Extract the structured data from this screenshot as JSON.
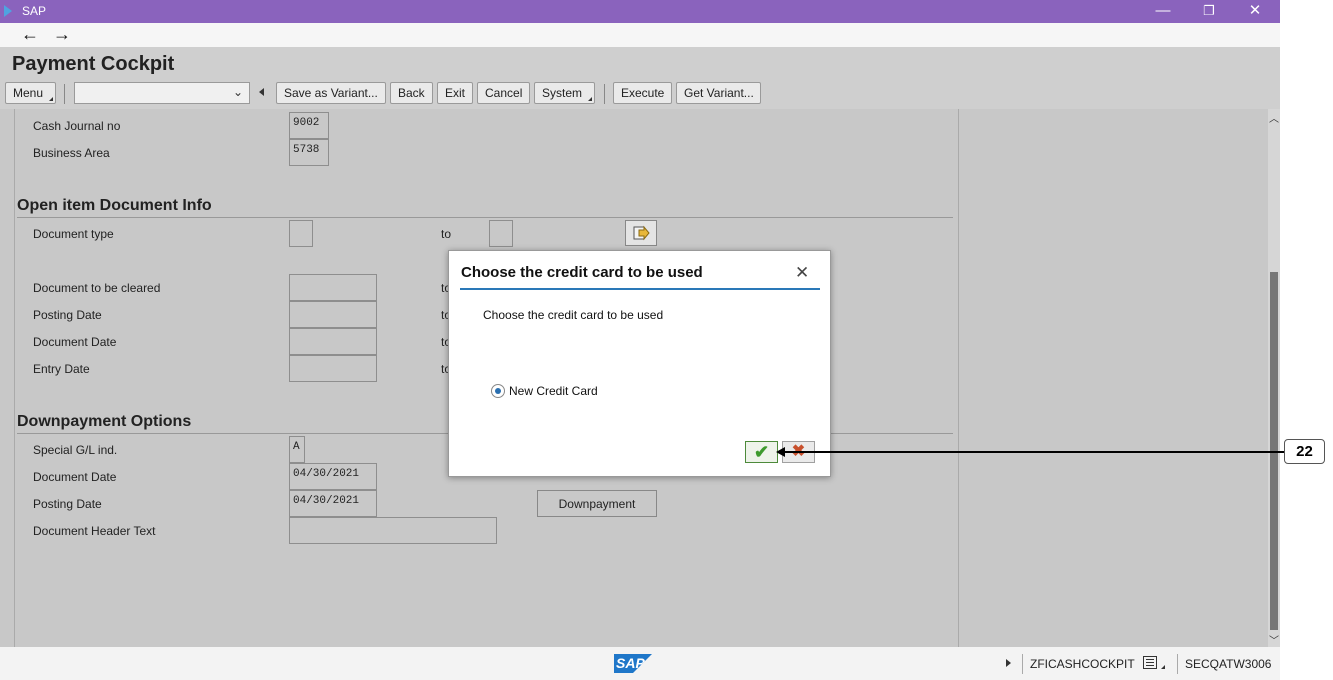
{
  "window": {
    "app_name": "SAP",
    "minimize_icon": "—",
    "restore_icon": "❐",
    "close_icon": "✕"
  },
  "nav": {
    "back_icon": "←",
    "forward_icon": "→"
  },
  "page_title": "Payment Cockpit",
  "toolbar": {
    "menu_label": "Menu",
    "variant_select_value": "",
    "save_variant_label": "Save as Variant...",
    "back_label": "Back",
    "exit_label": "Exit",
    "cancel_label": "Cancel",
    "system_label": "System",
    "execute_label": "Execute",
    "get_variant_label": "Get Variant..."
  },
  "cash_journal": {
    "cash_journal_label": "Cash Journal  no",
    "cash_journal_value": "9002",
    "business_area_label": "Business Area",
    "business_area_value": "5738"
  },
  "open_item": {
    "section_title": "Open item Document Info",
    "document_type_label": "Document type",
    "to_label": "to",
    "document_cleared_label": "Document to be cleared",
    "posting_date_label": "Posting Date",
    "document_date_label": "Document Date",
    "entry_date_label": "Entry Date",
    "to_partial": "to"
  },
  "downpayment": {
    "section_title": "Downpayment Options",
    "special_gl_label": "Special G/L ind.",
    "special_gl_value": "A",
    "document_date_label": "Document Date",
    "document_date_value": "04/30/2021",
    "posting_date_label": "Posting Date",
    "posting_date_value": "04/30/2021",
    "header_text_label": "Document Header Text",
    "header_text_value": "",
    "downpayment_button": "Downpayment"
  },
  "dialog": {
    "title": "Choose the credit card to be used",
    "message": "Choose the credit card to be used",
    "option_label": "New Credit Card",
    "option_selected": true,
    "ok_icon": "✔",
    "cancel_icon": "✖"
  },
  "callout": {
    "number": "22"
  },
  "status_bar": {
    "logo_text": "SAP",
    "transaction": "ZFICASHCOCKPIT",
    "system": "SECQATW3006"
  }
}
